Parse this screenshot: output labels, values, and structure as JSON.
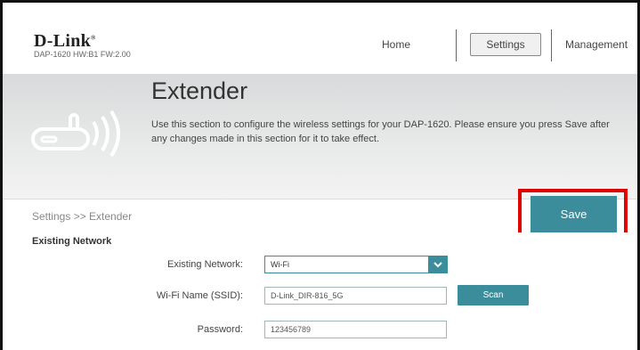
{
  "brand": {
    "name": "D-Link",
    "registered": "®",
    "model_info": "DAP-1620  HW:B1  FW:2.00"
  },
  "nav": {
    "home": "Home",
    "settings": "Settings",
    "management": "Management"
  },
  "banner": {
    "title": "Extender",
    "description": "Use this section to configure the wireless settings for your DAP-1620. Please ensure you press Save after any changes made in this section for it to take effect."
  },
  "breadcrumb": "Settings >> Extender",
  "save_label": "Save",
  "form": {
    "section_title": "Existing Network",
    "existing_network_label": "Existing Network:",
    "existing_network_value": "Wi-Fi",
    "ssid_label": "Wi-Fi Name (SSID):",
    "ssid_value": "D-Link_DIR-816_5G",
    "scan_label": "Scan",
    "password_label": "Password:",
    "password_value": "123456789"
  },
  "colors": {
    "accent": "#3c8d9c",
    "highlight": "#e00000"
  }
}
